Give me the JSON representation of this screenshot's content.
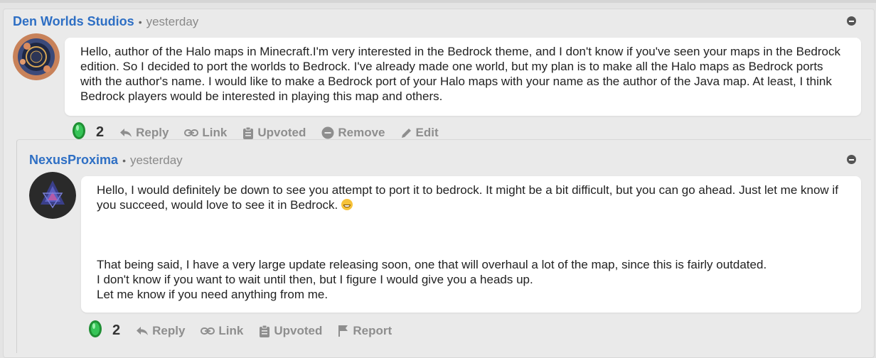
{
  "comments": [
    {
      "author": "Den Worlds Studios",
      "time": "yesterday",
      "body": "Hello, author of the Halo maps in Minecraft.I'm very interested in the Bedrock theme, and I don't know if you've seen your maps in the Bedrock edition. So I decided to port the worlds to Bedrock. I've already made one world, but my plan is to make all the Halo maps as Bedrock ports with the author's name. I would like to make a Bedrock port of your Halo maps with your name as the author of the Java map. At least, I think Bedrock players would be interested in playing this map and others.",
      "score": "2",
      "actions": {
        "reply": "Reply",
        "link": "Link",
        "upvoted": "Upvoted",
        "remove": "Remove",
        "edit": "Edit"
      }
    },
    {
      "author": "NexusProxima",
      "time": "yesterday",
      "body_line1": "Hello, I would definitely be down to see you attempt to port it to bedrock. It might be a bit difficult, but you can go ahead. Just let me know if you succeed, would love to see it in Bedrock.",
      "body_para2": "That being said, I have a very large update releasing soon, one that will overhaul a lot of the map, since this is fairly outdated.\nI don't know if you want to wait until then, but I figure I would give you a heads up.\nLet me know if you need anything from me.",
      "score": "2",
      "actions": {
        "reply": "Reply",
        "link": "Link",
        "upvoted": "Upvoted",
        "report": "Report"
      }
    }
  ],
  "separator": "•",
  "colors": {
    "author": "#2e6fc4",
    "action": "#8e8e8e",
    "emerald": "#1fa83a"
  }
}
